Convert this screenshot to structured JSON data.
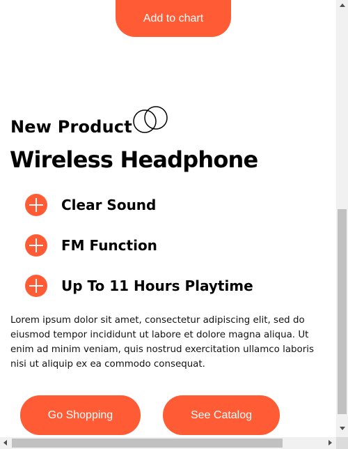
{
  "buttons": {
    "add_to_chart": "Add to chart",
    "go_shopping": "Go Shopping",
    "see_catalog": "See Catalog"
  },
  "product": {
    "eyebrow": "New Product",
    "title": "Wireless Headphone",
    "features": [
      {
        "label": "Clear Sound",
        "icon": "plus-circle-icon"
      },
      {
        "label": "FM Function",
        "icon": "plus-circle-icon"
      },
      {
        "label": "Up To 11 Hours Playtime",
        "icon": "plus-circle-icon"
      }
    ],
    "description": "Lorem ipsum dolor sit amet, consectetur adipiscing elit, sed do eiusmod tempor incididunt ut labore et dolore magna aliqua. Ut enim ad minim veniam, quis nostrud exercitation ullamco laboris nisi ut aliquip ex ea commodo consequat."
  },
  "colors": {
    "accent": "#ff5b35",
    "text": "#000000",
    "background": "#ffffff"
  },
  "decoration": {
    "icon": "interlocking-circles-icon"
  }
}
